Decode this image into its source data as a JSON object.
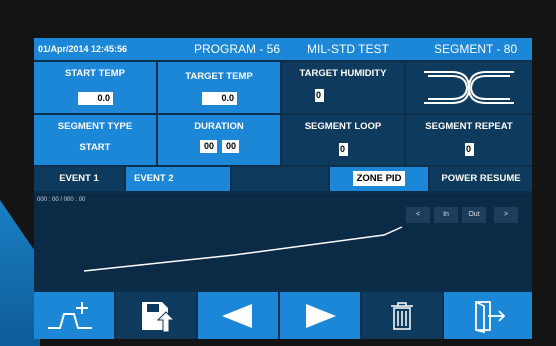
{
  "header": {
    "datetime": "01/Apr/2014 12:45:56",
    "program": "PROGRAM - 56",
    "test_name": "MIL-STD TEST",
    "segment": "SEGMENT - 80"
  },
  "fields": {
    "start_temp": {
      "label": "START TEMP",
      "value": "0.0"
    },
    "target_temp": {
      "label": "TARGET TEMP",
      "value": "0.0"
    },
    "target_humidity": {
      "label": "TARGET HUMIDITY",
      "value": "0"
    },
    "segment_type": {
      "label": "SEGMENT TYPE",
      "value": "START"
    },
    "duration": {
      "label": "DURATION",
      "hours": "00",
      "minutes": "00"
    },
    "segment_loop": {
      "label": "SEGMENT LOOP",
      "value": "0"
    },
    "segment_repeat": {
      "label": "SEGMENT REPEAT",
      "value": "0"
    }
  },
  "events": {
    "event1": "EVENT 1",
    "event2": "EVENT 2",
    "zone_pid": "ZONE PID",
    "power_resume": "POWER RESUME"
  },
  "graph": {
    "time_readout": "000 : 00  / 000 : 00",
    "btn_back": "<",
    "btn_in": "In",
    "btn_out": "Out",
    "btn_forward": ">"
  },
  "toolbar": {
    "icons": [
      "add-segment-icon",
      "save-icon",
      "previous-icon",
      "next-icon",
      "delete-icon",
      "exit-icon"
    ]
  },
  "colors": {
    "accent": "#1b87d6",
    "panel": "#0e3a5e",
    "background": "#0c2f4c"
  }
}
